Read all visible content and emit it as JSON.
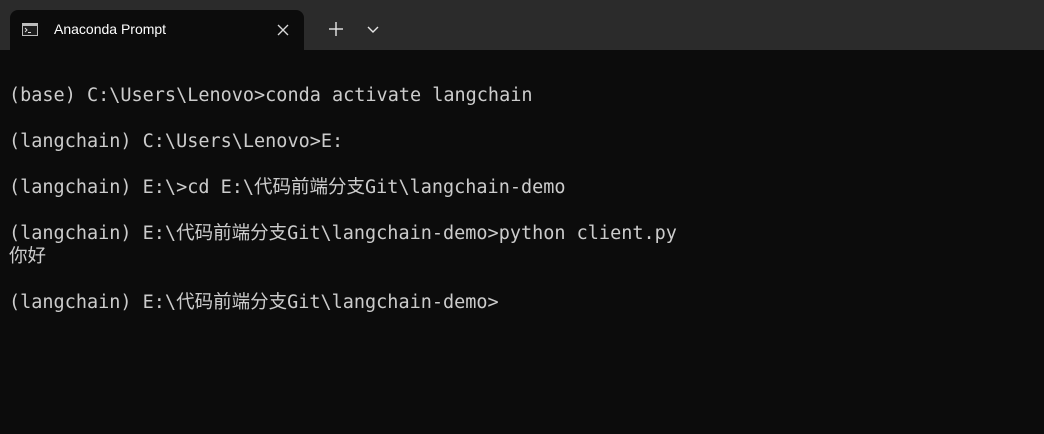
{
  "tab": {
    "title": "Anaconda Prompt",
    "icon": "console-icon"
  },
  "toolbar": {
    "new_tab_icon": "plus-icon",
    "dropdown_icon": "chevron-down-icon",
    "close_icon": "close-icon"
  },
  "console": {
    "lines": [
      "(base) C:\\Users\\Lenovo>conda activate langchain",
      "(langchain) C:\\Users\\Lenovo>E:",
      "(langchain) E:\\>cd E:\\代码前端分支Git\\langchain-demo",
      "(langchain) E:\\代码前端分支Git\\langchain-demo>python client.py",
      "你好",
      "(langchain) E:\\代码前端分支Git\\langchain-demo>"
    ]
  },
  "colors": {
    "background": "#0c0c0c",
    "tabbar": "#2b2b2b",
    "text": "#cccccc"
  }
}
